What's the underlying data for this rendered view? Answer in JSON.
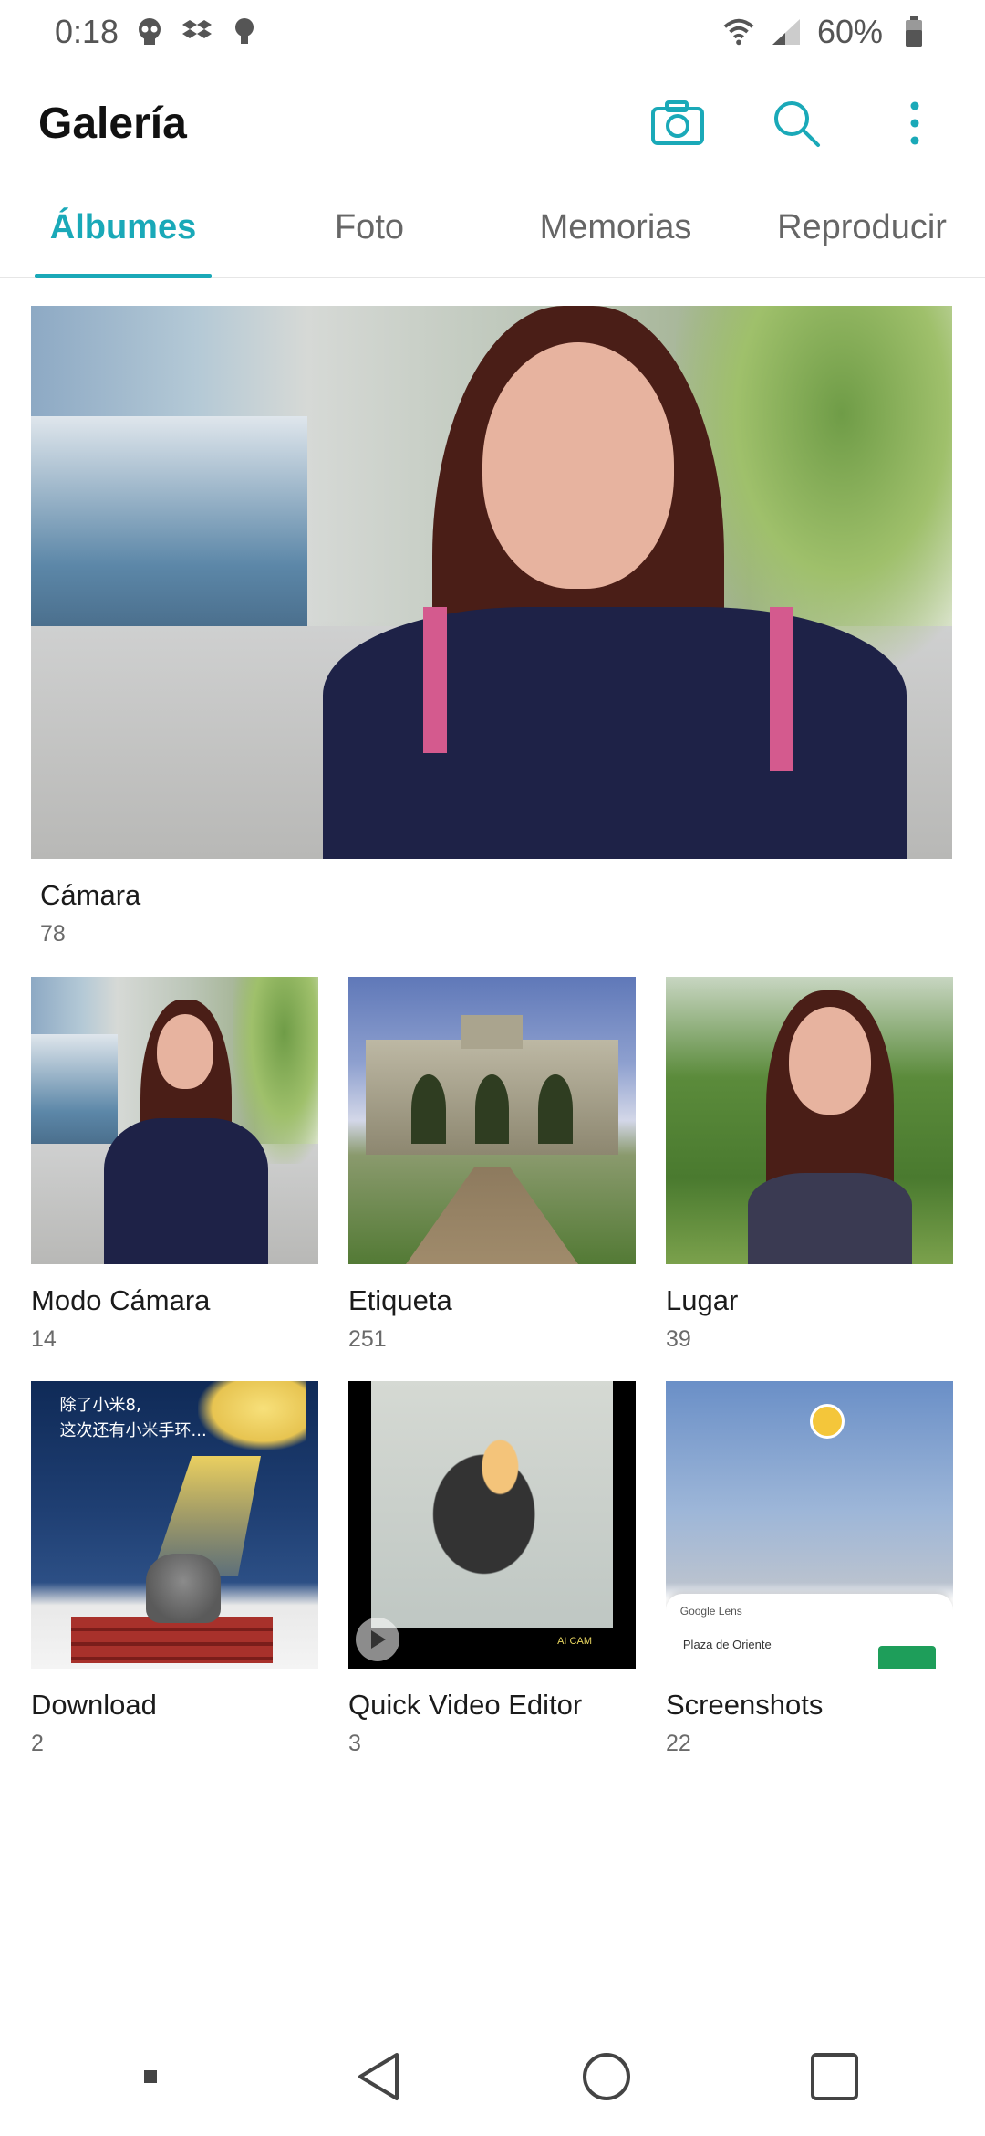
{
  "status_bar": {
    "time": "0:18",
    "battery": "60%",
    "left_icons": [
      "skull-icon",
      "dropbox-icon",
      "lightbulb-icon"
    ],
    "right_icons": [
      "wifi-icon",
      "signal-icon",
      "battery-icon"
    ]
  },
  "app_bar": {
    "title": "Galería",
    "actions": [
      "camera-icon",
      "search-icon",
      "more-vert-icon"
    ]
  },
  "tabs": [
    {
      "label": "Álbumes",
      "active": true
    },
    {
      "label": "Foto",
      "active": false
    },
    {
      "label": "Memorias",
      "active": false
    },
    {
      "label": "Reproducir",
      "active": false
    }
  ],
  "albums": {
    "featured": {
      "name": "Cámara",
      "count": "78"
    },
    "grid": [
      {
        "name": "Modo Cámara",
        "count": "14"
      },
      {
        "name": "Etiqueta",
        "count": "251"
      },
      {
        "name": "Lugar",
        "count": "39"
      },
      {
        "name": "Download",
        "count": "2"
      },
      {
        "name": "Quick Video Editor",
        "count": "3"
      },
      {
        "name": "Screenshots",
        "count": "22"
      }
    ]
  },
  "thumbnail_text": {
    "download_line1": "除了小米8,",
    "download_line2": "这次还有小米手环...",
    "video_watermark": "AI CAM",
    "lens_label": "Google Lens",
    "place_label": "Plaza de Oriente"
  },
  "colors": {
    "accent": "#1aa9b8"
  },
  "nav_bar": [
    "square-small-icon",
    "back-icon",
    "home-icon",
    "recents-icon"
  ]
}
